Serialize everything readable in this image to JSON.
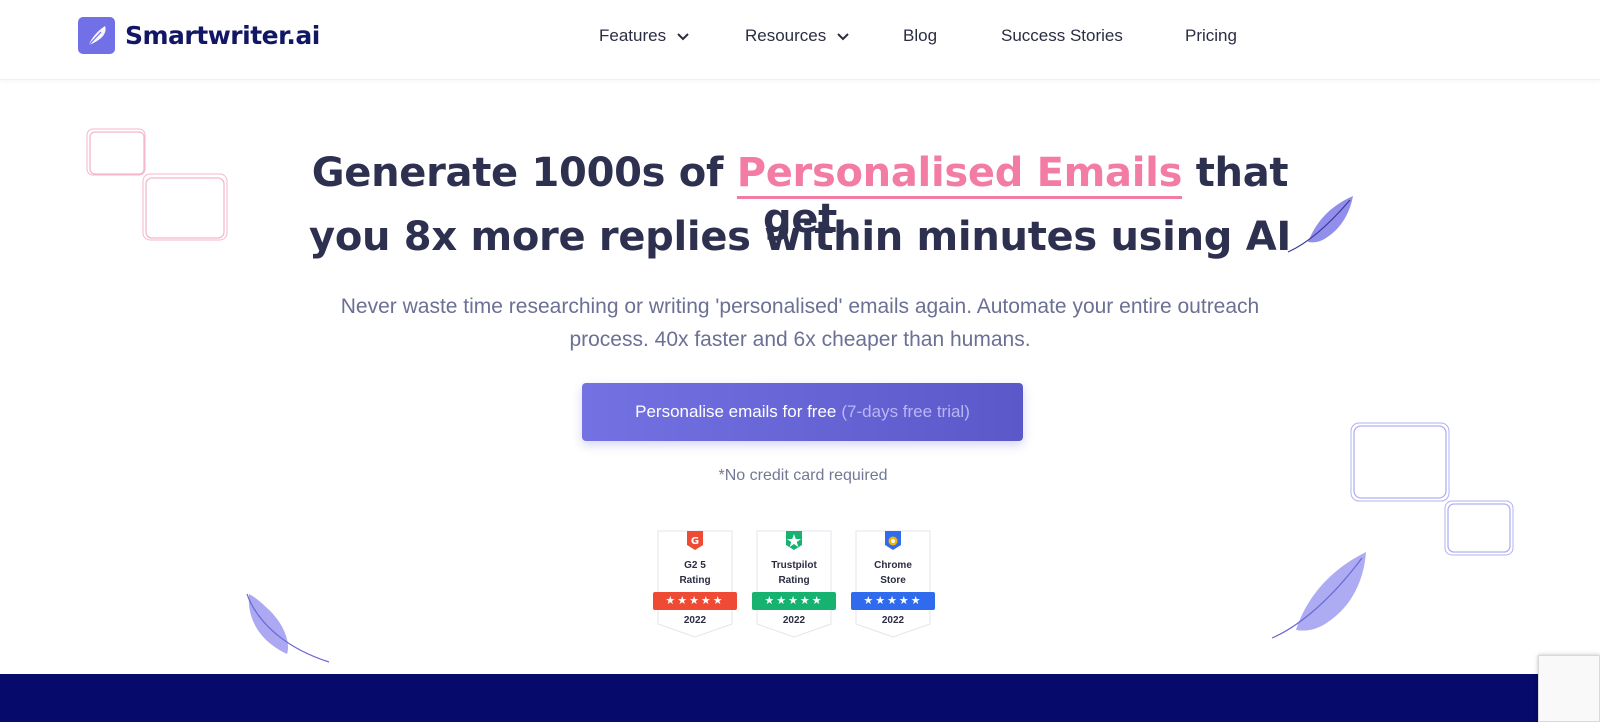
{
  "brand": {
    "name": "Smartwriter.ai",
    "color": "#121765",
    "accent": "#7170e6",
    "icon": "feather-icon"
  },
  "nav": {
    "items": [
      {
        "label": "Features",
        "dropdown": true
      },
      {
        "label": "Resources",
        "dropdown": true
      },
      {
        "label": "Blog",
        "dropdown": false
      },
      {
        "label": "Success Stories",
        "dropdown": false
      },
      {
        "label": "Pricing",
        "dropdown": false
      }
    ]
  },
  "hero": {
    "line1_prefix": "Generate 1000s of",
    "line1_highlight": "Personalised Emails",
    "line1_suffix": "that get",
    "line2": "you 8x more replies within minutes using AI",
    "subtitle_line1": "Never waste time researching or writing 'personalised' emails again. Automate your entire outreach",
    "subtitle_line2": "process. 40x faster and 6x cheaper than humans.",
    "cta_label": "Personalise emails for free",
    "cta_note": "(7-days free trial)",
    "no_credit_card": "*No credit card required",
    "highlight_color": "#f27ca3"
  },
  "badges": [
    {
      "line1": "G2 5",
      "line2": "Rating",
      "stars": "★★★★★",
      "year": "2022",
      "color": "#ef4a34",
      "icon": "g2-icon"
    },
    {
      "line1": "Trustpilot",
      "line2": "Rating",
      "stars": "★★★★★",
      "year": "2022",
      "color": "#16b370",
      "icon": "trustpilot-star-icon"
    },
    {
      "line1": "Chrome",
      "line2": "Store",
      "stars": "★★★★★",
      "year": "2022",
      "color": "#2f6bec",
      "icon": "chrome-store-icon"
    }
  ],
  "colors": {
    "band": "#050a6b",
    "cta_start": "#7472e3",
    "cta_end": "#5b58c9"
  }
}
